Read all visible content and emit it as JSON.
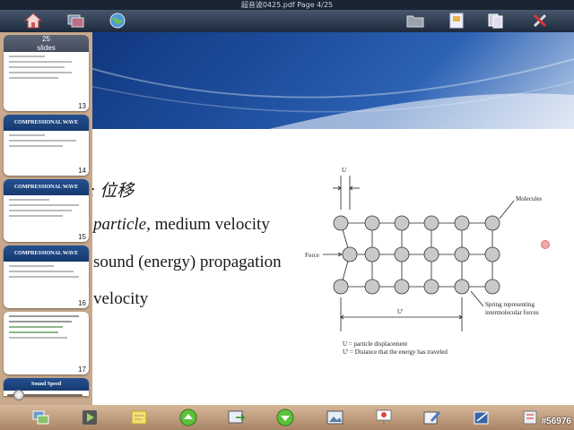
{
  "window": {
    "title": "超音波0425.pdf  Page 4/25"
  },
  "toolbar": {
    "left_icons": [
      "home-icon",
      "layers-icon",
      "globe-icon"
    ],
    "right_icons": [
      "folder-icon",
      "bookmark-icon",
      "pages-icon",
      "tools-icon"
    ]
  },
  "sidebar": {
    "header_count": "25",
    "header_label": "slides",
    "thumbnails": [
      {
        "number": "13",
        "header": ""
      },
      {
        "number": "14",
        "header": "COMPRESSIONAL WAVE"
      },
      {
        "number": "15",
        "header": "COMPRESSIONAL WAVE"
      },
      {
        "number": "16",
        "header": "COMPRESSIONAL WAVE"
      },
      {
        "number": "17",
        "header": ""
      },
      {
        "number": "",
        "header": "Sound Speed"
      }
    ],
    "zoom_slider": {
      "value": 0.1
    }
  },
  "slide": {
    "line1": ": 位移",
    "line2_italic": "particle,",
    "line2_rest": " medium velocity",
    "line3": "sound (energy) propagation",
    "line4": "velocity"
  },
  "diagram": {
    "label_u_top": "U",
    "label_molecules": "Molecules",
    "label_force": "Force",
    "label_u_prime": "U'",
    "label_spring_1": "Spring representing",
    "label_spring_2": "intermolecular forces",
    "caption_1": "U = particle displacement",
    "caption_2": "U' = Distance that the energy has traveled"
  },
  "bottom_toolbar": {
    "icons": [
      "slides-icon",
      "play-icon",
      "note-icon",
      "up-arrow-icon",
      "export-icon",
      "down-arrow-icon",
      "image-icon",
      "presentation-icon",
      "edit-icon",
      "draw-icon",
      "settings-icon"
    ]
  },
  "watermark": "#56976"
}
